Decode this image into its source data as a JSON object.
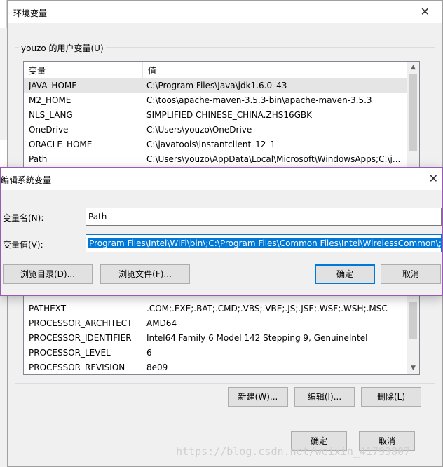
{
  "bg_window": {
    "title": "环境变量",
    "close_glyph": "✕",
    "user_vars": {
      "group_label": "youzo 的用户变量(U)",
      "columns": [
        "变量",
        "值"
      ],
      "rows": [
        {
          "name": "JAVA_HOME",
          "value": "C:\\Program Files\\Java\\jdk1.6.0_43",
          "selected": true
        },
        {
          "name": "M2_HOME",
          "value": "C:\\toos\\apache-maven-3.5.3-bin\\apache-maven-3.5.3"
        },
        {
          "name": "NLS_LANG",
          "value": "SIMPLIFIED CHINESE_CHINA.ZHS16GBK"
        },
        {
          "name": "OneDrive",
          "value": "C:\\Users\\youzo\\OneDrive"
        },
        {
          "name": "ORACLE_HOME",
          "value": "C:\\javatools\\instantclient_12_1"
        },
        {
          "name": "Path",
          "value": "C:\\Users\\youzo\\AppData\\Local\\Microsoft\\WindowsApps;C:\\j..."
        }
      ]
    },
    "system_vars": {
      "rows": [
        {
          "name": "PATHEXT",
          "value": ".COM;.EXE;.BAT;.CMD;.VBS;.VBE;.JS;.JSE;.WSF;.WSH;.MSC"
        },
        {
          "name": "PROCESSOR_ARCHITECT",
          "value": "AMD64"
        },
        {
          "name": "PROCESSOR_IDENTIFIER",
          "value": "Intel64 Family 6 Model 142 Stepping 9, GenuineIntel"
        },
        {
          "name": "PROCESSOR_LEVEL",
          "value": "6"
        },
        {
          "name": "PROCESSOR_REVISION",
          "value": "8e09"
        }
      ],
      "buttons": {
        "new": "新建(W)...",
        "edit": "编辑(I)...",
        "delete": "删除(L)"
      }
    },
    "ok_label": "确定",
    "cancel_label": "取消",
    "scroll_up_glyph": "▲",
    "scroll_down_glyph": "▼"
  },
  "edit_dialog": {
    "title": "编辑系统变量",
    "close_glyph": "✕",
    "name_label": "变量名(N):",
    "name_value": "Path",
    "value_label": "变量值(V):",
    "value_value": "Program Files\\Intel\\WiFi\\bin\\;C:\\Program Files\\Common Files\\Intel\\WirelessCommon\\;",
    "browse_dir_label": "浏览目录(D)...",
    "browse_file_label": "浏览文件(F)...",
    "ok_label": "确定",
    "cancel_label": "取消"
  },
  "watermark": "https://blog.csdn.net/weixin_41793807",
  "colors": {
    "accent": "#0078d7",
    "dialog_border": "#9b59b6"
  }
}
